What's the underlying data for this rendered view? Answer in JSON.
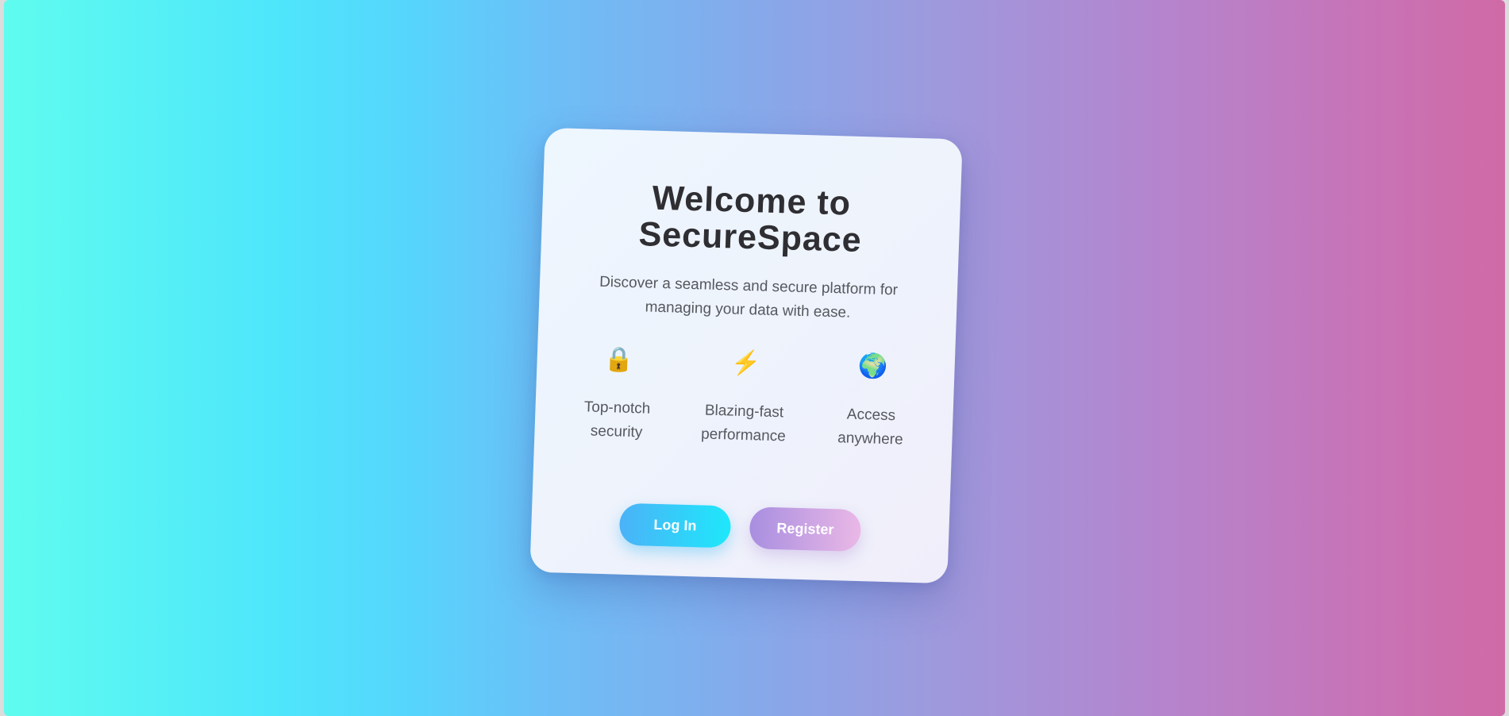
{
  "card": {
    "title": "Welcome to SecureSpace",
    "subtitle": "Discover a seamless and secure platform for managing your data with ease."
  },
  "features": [
    {
      "icon": "lock-icon",
      "glyph": "🔒",
      "label": "Top-notch security"
    },
    {
      "icon": "lightning-icon",
      "glyph": "⚡",
      "label": "Blazing-fast performance"
    },
    {
      "icon": "globe-icon",
      "glyph": "🌍",
      "label": "Access anywhere"
    }
  ],
  "buttons": {
    "login_label": "Log In",
    "register_label": "Register"
  },
  "colors": {
    "background_start": "#5ffcef",
    "background_end": "#d06aa6",
    "login_start": "#4bb2f7",
    "login_end": "#1ee8fb",
    "register_start": "#a88ee0",
    "register_end": "#eab8e6",
    "title_text": "#2e2e33",
    "body_text": "#55585f"
  }
}
